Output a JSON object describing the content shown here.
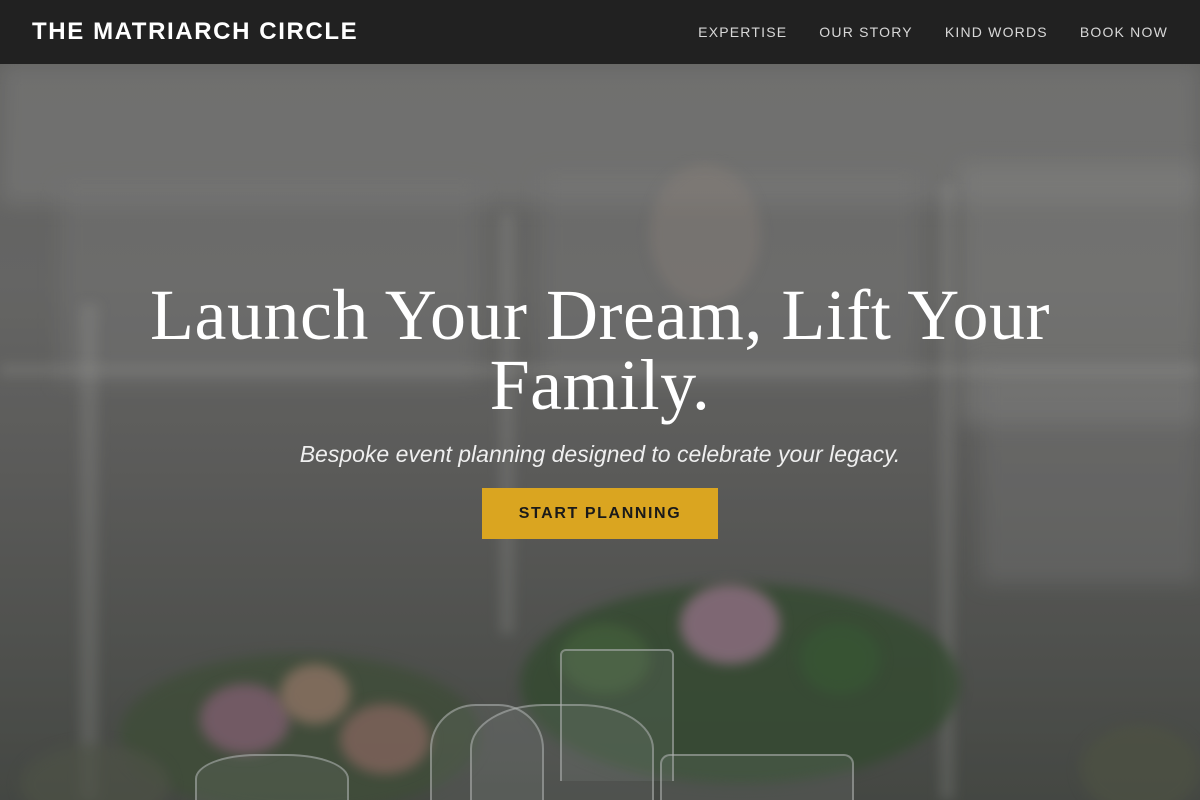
{
  "navbar": {
    "brand": "THE MATRIARCH CIRCLE",
    "links": [
      {
        "label": "EXPERTISE"
      },
      {
        "label": "OUR STORY"
      },
      {
        "label": "KIND WORDS"
      },
      {
        "label": "BOOK NOW"
      }
    ],
    "background_color": "#212121"
  },
  "hero": {
    "title": "Launch Your Dream, Lift Your Family.",
    "subtitle": "Bespoke event planning designed to celebrate your legacy.",
    "cta_label": "START PLANNING",
    "cta_color": "#daa520",
    "background_image": "blurred tent interior with floral centerpieces and wine glasses"
  }
}
